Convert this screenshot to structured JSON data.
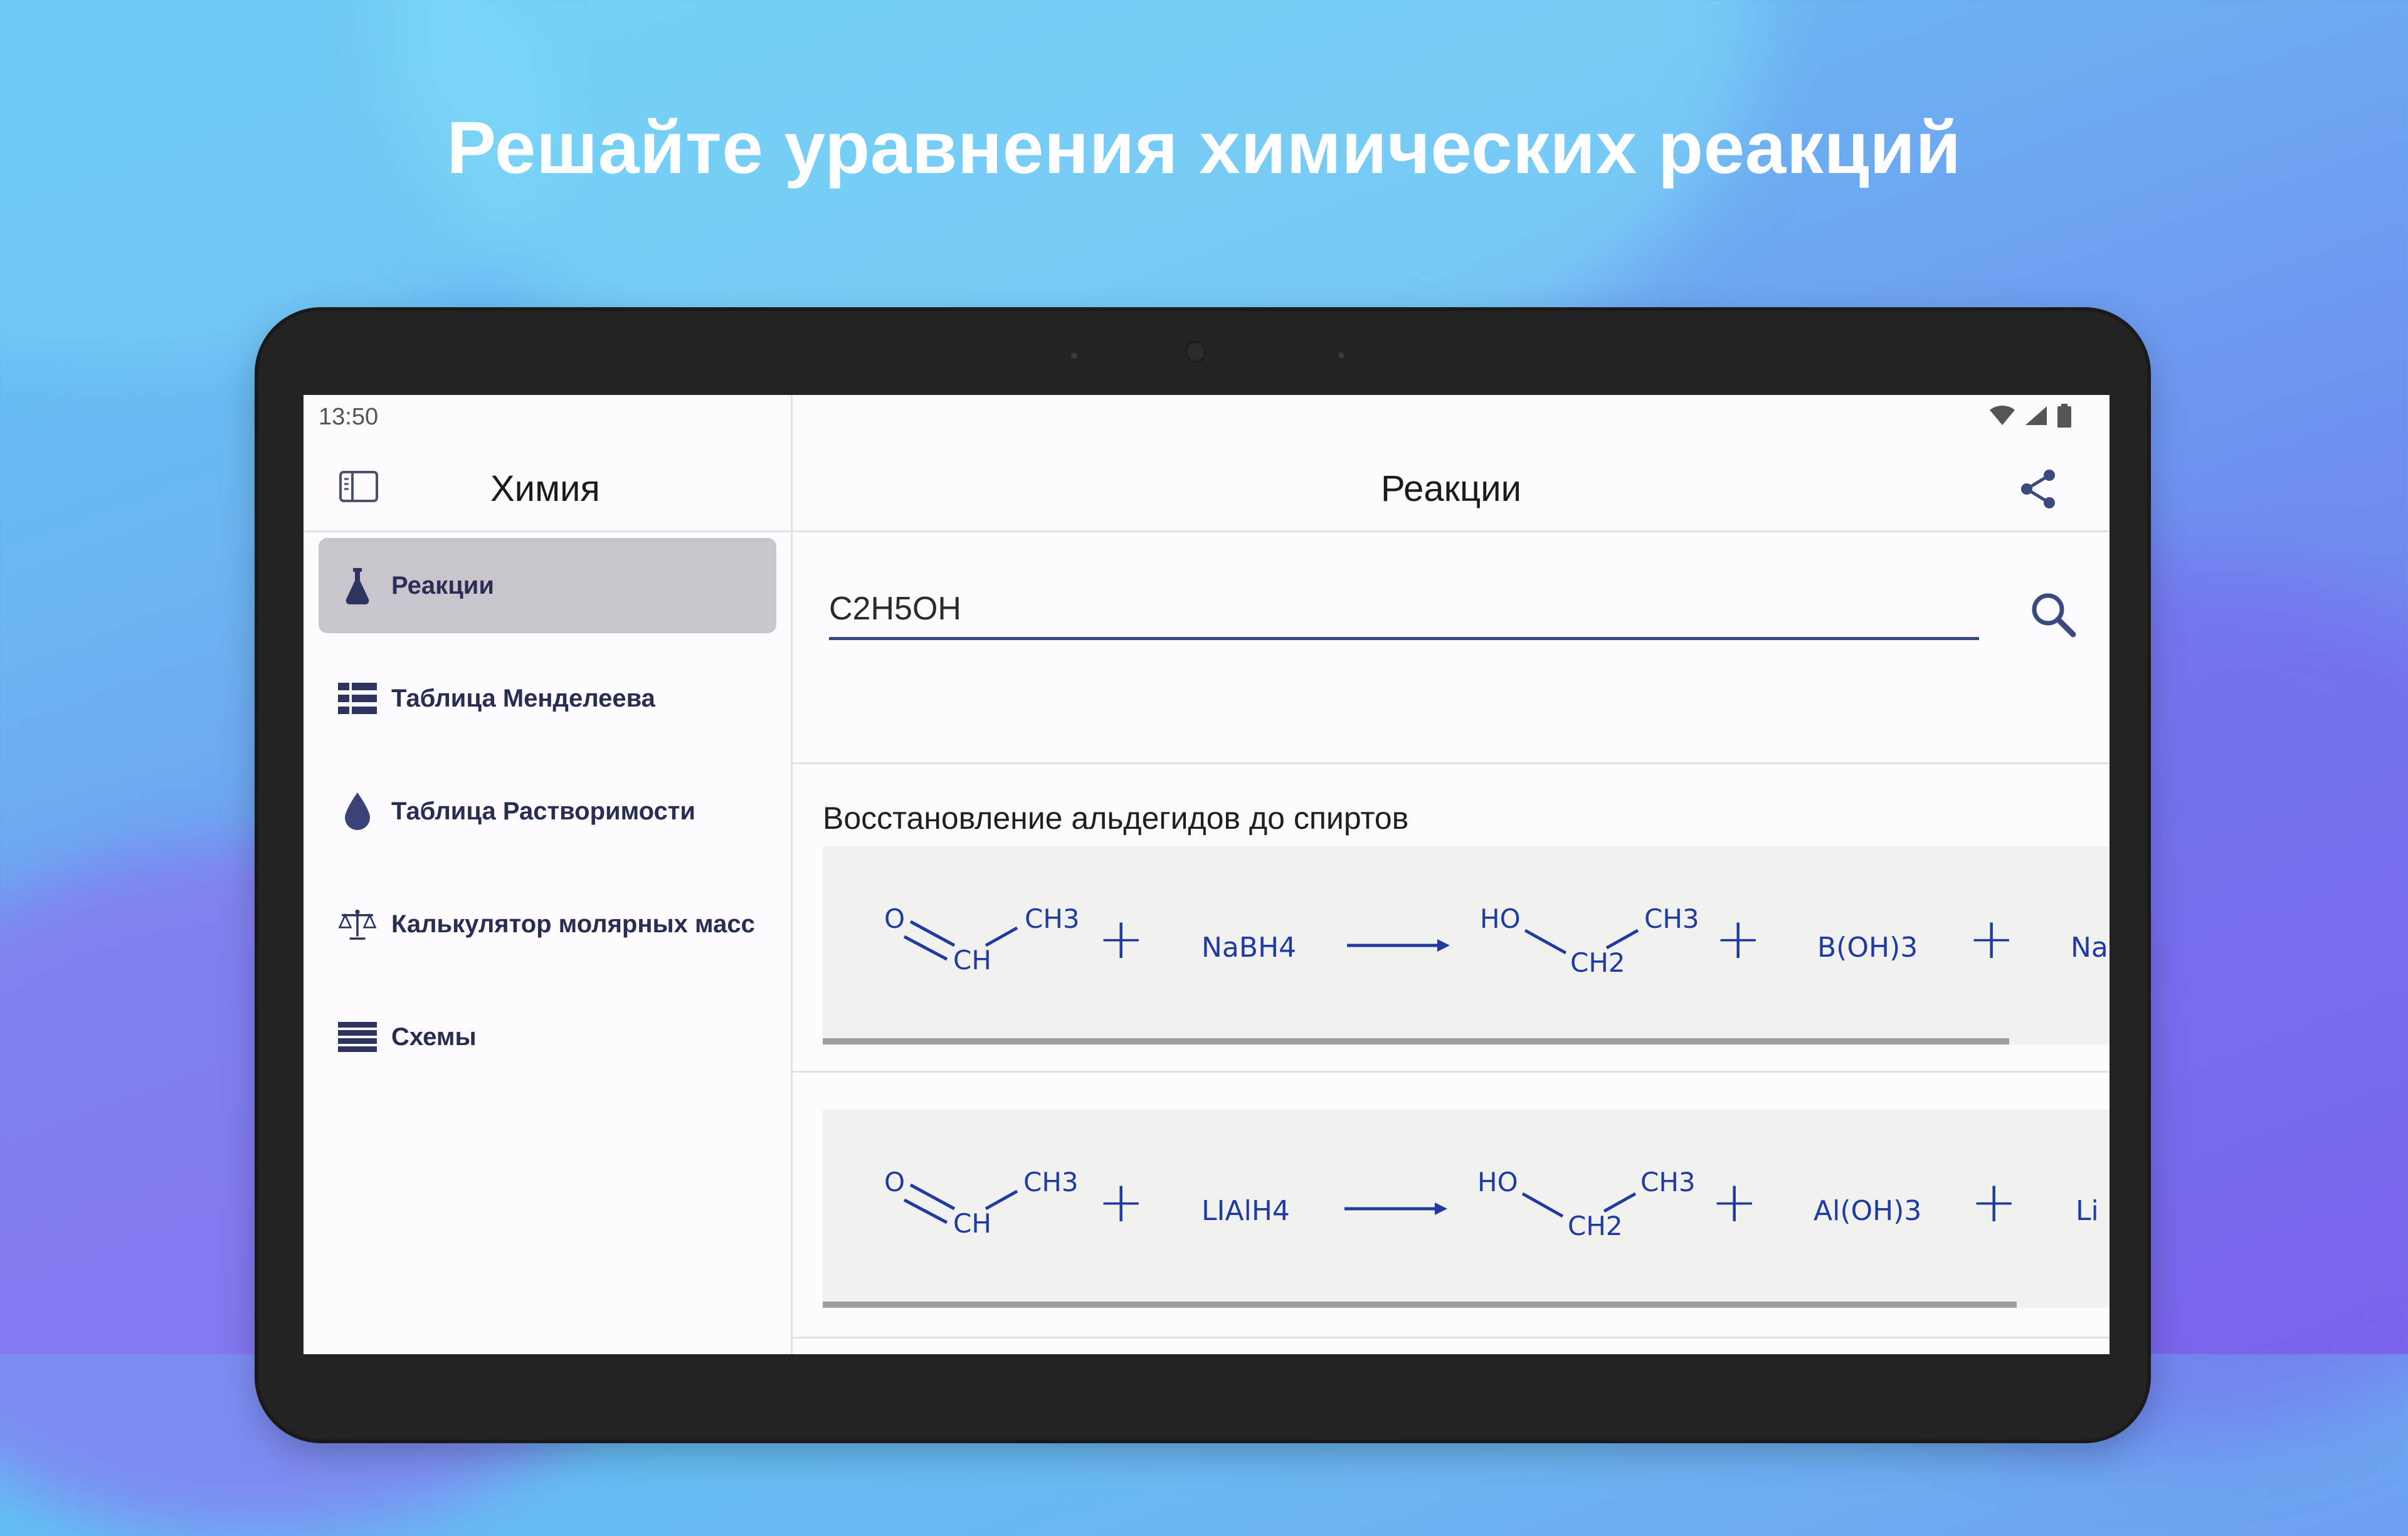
{
  "headline": "Решайте уравнения химических реакций",
  "status_bar": {
    "time": "13:50",
    "icons": [
      "wifi-icon",
      "signal-icon",
      "battery-icon"
    ]
  },
  "sidebar": {
    "toggle_icon": "sidebar-toggle-icon",
    "title": "Химия",
    "items": [
      {
        "label": "Реакции",
        "icon": "flask-icon",
        "active": true
      },
      {
        "label": "Таблица Менделеева",
        "icon": "grid-icon",
        "active": false
      },
      {
        "label": "Таблица Растворимости",
        "icon": "drop-icon",
        "active": false
      },
      {
        "label": "Калькулятор молярных масс",
        "icon": "scales-icon",
        "active": false
      },
      {
        "label": "Схемы",
        "icon": "list-icon",
        "active": false
      }
    ]
  },
  "main": {
    "title": "Реакции",
    "share_icon": "share-icon",
    "search": {
      "value": "C2H5OH",
      "icon": "search-icon"
    },
    "section_title": "Восстановление альдегидов до спиртов",
    "reactions": [
      {
        "reactant1": {
          "o": "O",
          "ch": "CH",
          "ch3": "CH3"
        },
        "plus": "+",
        "reagent": "NaBH4",
        "product1": {
          "ho": "HO",
          "ch2": "CH2",
          "ch3": "CH3"
        },
        "byproduct": "B(OH)3",
        "tail": "Na",
        "scroll_fraction": 0.76
      },
      {
        "reactant1": {
          "o": "O",
          "ch": "CH",
          "ch3": "CH3"
        },
        "plus": "+",
        "reagent": "LIAlH4",
        "product1": {
          "ho": "HO",
          "ch2": "CH2",
          "ch3": "CH3"
        },
        "byproduct": "Al(OH)3",
        "tail": "Li",
        "scroll_fraction": 0.76
      }
    ],
    "colors": {
      "formula": "#1f3aa0",
      "accent": "#3b4a7e",
      "active_nav": "#cac5cc"
    }
  }
}
